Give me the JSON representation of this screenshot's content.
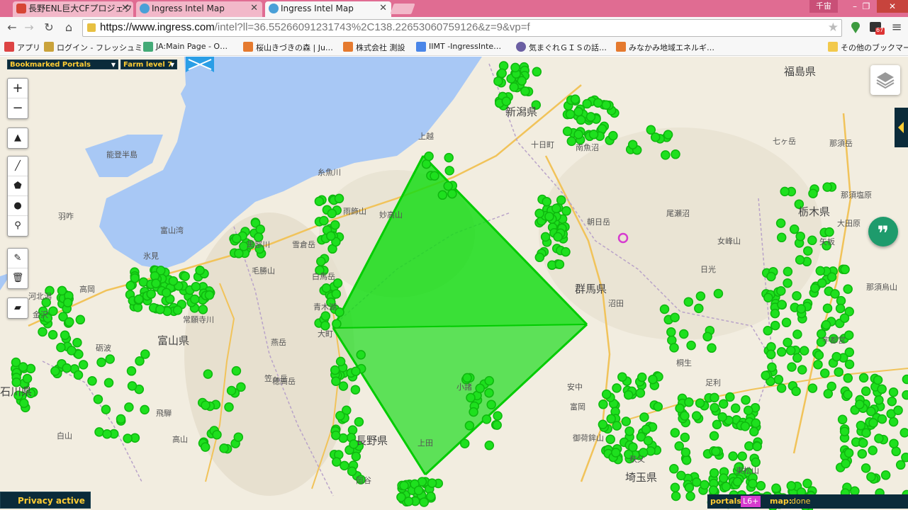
{
  "browser": {
    "tabs": [
      {
        "title": "長野ENL巨大CFプロジェクト",
        "active": false,
        "icon_color": "#d64535"
      },
      {
        "title": "Ingress Intel Map",
        "active": false,
        "icon_color": "#4aa0d8"
      },
      {
        "title": "Ingress Intel Map",
        "active": true,
        "icon_color": "#4aa0d8"
      }
    ],
    "user_label": "千宙",
    "window_buttons": {
      "minimize": "–",
      "maximize": "❐",
      "close": "✕"
    },
    "url_host": "https://www.ingress.com",
    "url_path": "/intel?ll=36.55266091231743%2C138.22653060759126&z=9&vp=f",
    "extension_badge": "67",
    "bookmarks": [
      {
        "label": "アプリ",
        "icon_color": "#d44"
      },
      {
        "label": "ログイン - フレッシュミ…",
        "icon_color": "#caa33b"
      },
      {
        "label": "JA:Main Page - O…",
        "icon_color": "#4a7"
      },
      {
        "label": "桜山きづきの森 | Ju…",
        "icon_color": "#e57a2f"
      },
      {
        "label": "株式会社 測設",
        "icon_color": "#e57a2f"
      },
      {
        "label": "IIMT -IngressInte…",
        "icon_color": "#4a86e8"
      },
      {
        "label": "気まぐれＧＩＳの話…",
        "icon_color": "#6b5fa3"
      },
      {
        "label": "みなかみ地域エネルギ…",
        "icon_color": "#e57a2f"
      },
      {
        "label": "その他のブックマーク",
        "icon_color": "#f2c94c"
      }
    ]
  },
  "map": {
    "selectors": {
      "bookmarks": "Bookmarked Portals",
      "farm": "Farm level 7"
    },
    "zoom_in": "+",
    "zoom_out": "−",
    "labels": [
      {
        "text": "福島県",
        "big": true
      },
      {
        "text": "新潟県",
        "big": true
      },
      {
        "text": "群馬県",
        "big": true
      },
      {
        "text": "栃木県",
        "big": true
      },
      {
        "text": "富山県",
        "big": true
      },
      {
        "text": "長野県",
        "big": true
      },
      {
        "text": "石川県",
        "big": true
      },
      {
        "text": "埼玉県",
        "big": true
      },
      {
        "text": "能登半島"
      },
      {
        "text": "富山湾"
      },
      {
        "text": "羽咋"
      },
      {
        "text": "氷見"
      },
      {
        "text": "高岡"
      },
      {
        "text": "河北潟"
      },
      {
        "text": "金沢"
      },
      {
        "text": "糸魚川"
      },
      {
        "text": "妙高山"
      },
      {
        "text": "雨飾山"
      },
      {
        "text": "黒部川"
      },
      {
        "text": "雪倉岳"
      },
      {
        "text": "白馬岳"
      },
      {
        "text": "青木湖"
      },
      {
        "text": "大町"
      },
      {
        "text": "常願寺川"
      },
      {
        "text": "毛勝山"
      },
      {
        "text": "燕岳"
      },
      {
        "text": "穂高岳"
      },
      {
        "text": "飛騨"
      },
      {
        "text": "高山"
      },
      {
        "text": "白山"
      },
      {
        "text": "砺波"
      },
      {
        "text": "上越"
      },
      {
        "text": "十日町"
      },
      {
        "text": "南魚沼"
      },
      {
        "text": "朝日岳"
      },
      {
        "text": "尾瀬沼"
      },
      {
        "text": "女峰山"
      },
      {
        "text": "日光"
      },
      {
        "text": "沼田"
      },
      {
        "text": "桐生"
      },
      {
        "text": "足利"
      },
      {
        "text": "安中"
      },
      {
        "text": "富岡"
      },
      {
        "text": "御荷鉾山"
      },
      {
        "text": "小諸"
      },
      {
        "text": "那須塩原"
      },
      {
        "text": "那須烏山"
      },
      {
        "text": "大田原"
      },
      {
        "text": "矢板"
      },
      {
        "text": "七ヶ岳"
      },
      {
        "text": "那須岳"
      },
      {
        "text": "宇都宮"
      },
      {
        "text": "秩父"
      },
      {
        "text": "東松山"
      },
      {
        "text": "岡谷"
      },
      {
        "text": "上田"
      },
      {
        "text": "笠ヶ岳"
      }
    ],
    "privacy": "Privacy active",
    "status": {
      "portals_label": "portals:",
      "level": "L6+",
      "map_label": "map:",
      "map_value": "done"
    }
  }
}
